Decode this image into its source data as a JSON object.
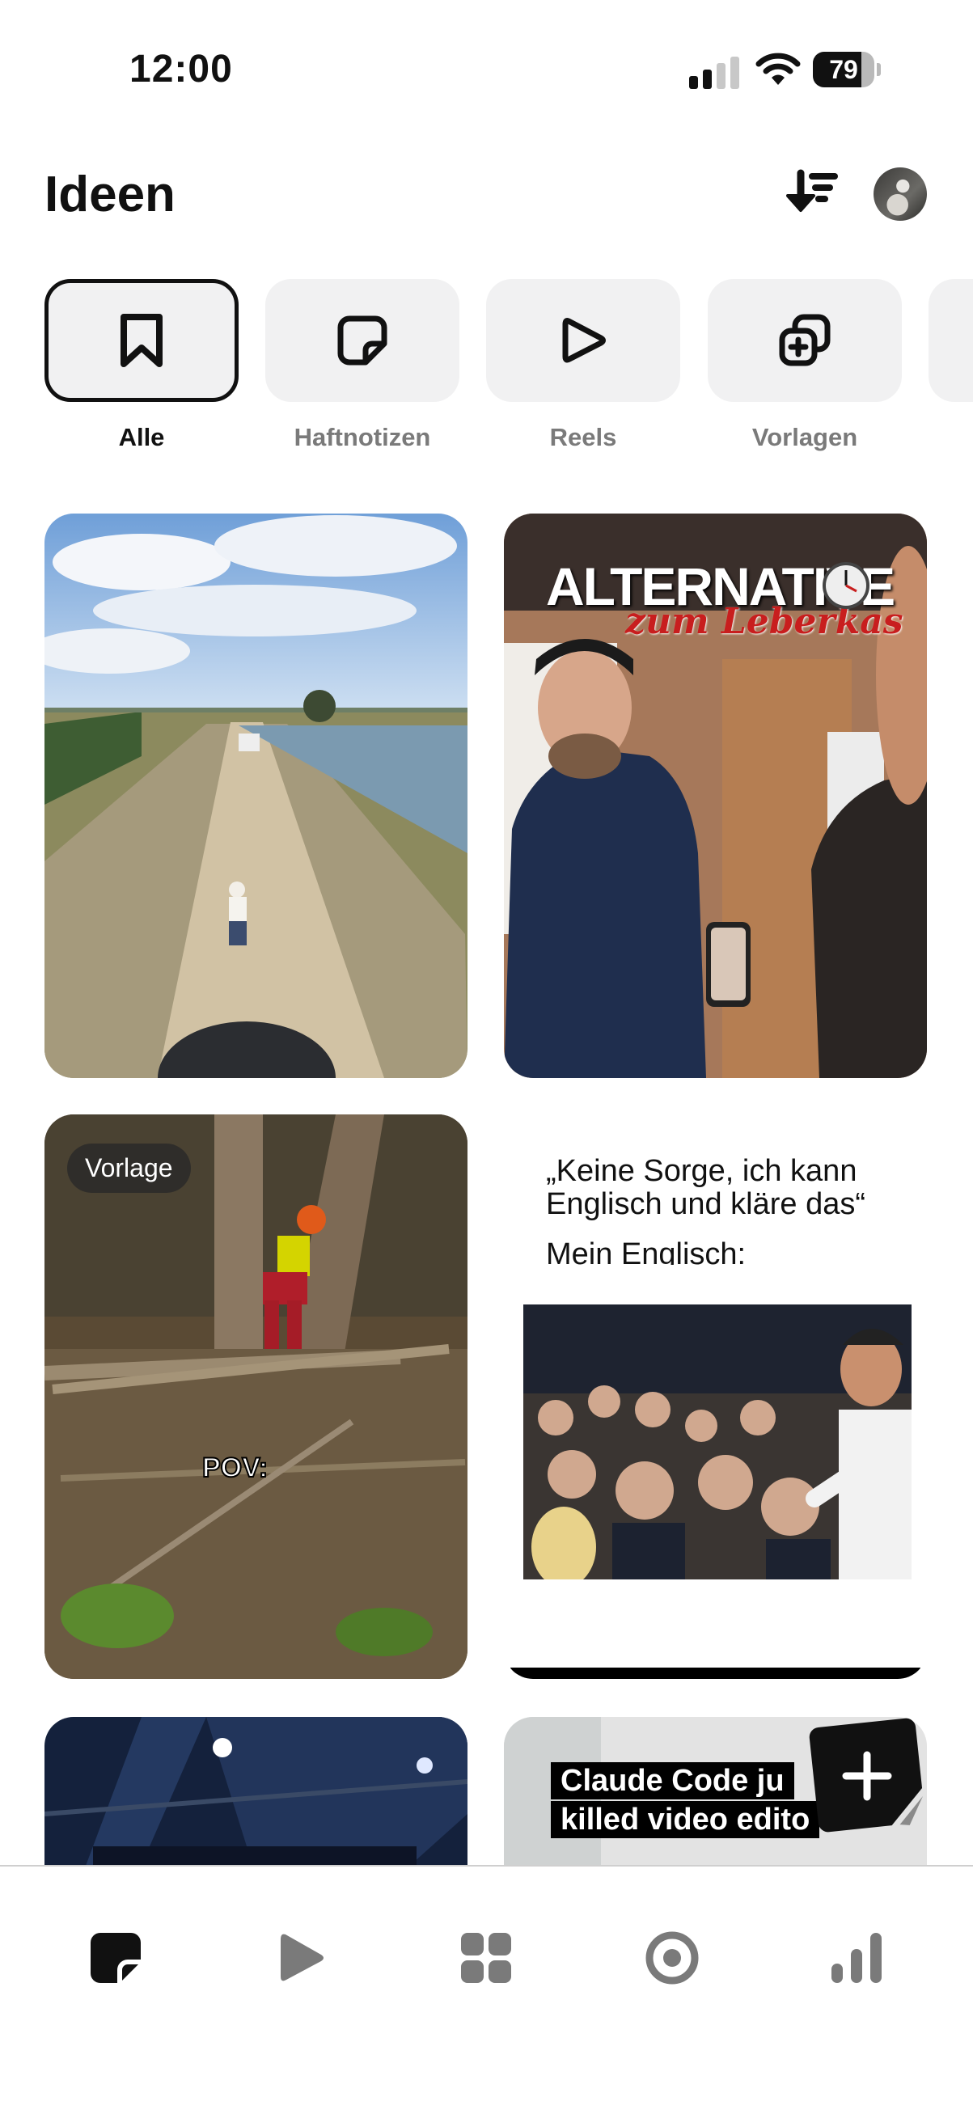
{
  "status_bar": {
    "time": "12:00",
    "battery": "79",
    "battery_level": 0.79
  },
  "header": {
    "title": "Ideen"
  },
  "filters": [
    {
      "label": "Alle",
      "icon": "bookmark-icon",
      "active": true
    },
    {
      "label": "Haftnotizen",
      "icon": "sticky-note-icon",
      "active": false
    },
    {
      "label": "Reels",
      "icon": "play-icon",
      "active": false
    },
    {
      "label": "Vorlagen",
      "icon": "template-icon",
      "active": false
    }
  ],
  "feed": {
    "card2_title": "ALTERNATIVE",
    "card2_subtitle": "zum Leberkas",
    "card3_badge": "Vorlage",
    "card3_caption": "POV:",
    "card4_text_line1": "„Keine Sorge, ich kann",
    "card4_text_line2": "Englisch und kläre das“",
    "card4_text_line3": "Mein Englisch:",
    "card6_headline_line1": "Claude Code ju",
    "card6_headline_line2": "killed video edito"
  },
  "bottom_nav": [
    {
      "icon": "notes-icon",
      "active": true
    },
    {
      "icon": "play-icon",
      "active": false
    },
    {
      "icon": "grid-icon",
      "active": false
    },
    {
      "icon": "target-icon",
      "active": false
    },
    {
      "icon": "stats-icon",
      "active": false
    }
  ],
  "colors": {
    "accent": "#111111",
    "inactive": "#7a7a7a",
    "chip_bg": "#f1f1f2"
  }
}
